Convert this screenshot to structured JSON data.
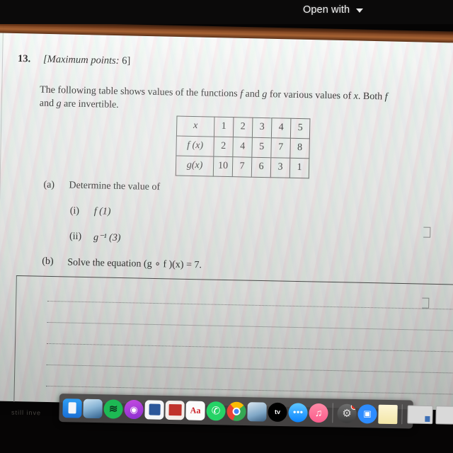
{
  "viewer": {
    "open_with_label": "Open with",
    "caret_icon": "chevron-down-icon"
  },
  "document": {
    "question_number": "13.",
    "marks_open": "[Maximum points:",
    "marks_value": " 6]",
    "stem_line1": "The following table shows values of the functions ",
    "stem_f1": "f",
    "stem_mid1": " and ",
    "stem_g1": "g",
    "stem_mid2": " for various values of ",
    "stem_x": "x",
    "stem_mid3": ". Both ",
    "stem_f2": "f",
    "stem_mid4": " and ",
    "stem_g2": "g",
    "stem_end": " are invertible.",
    "table": {
      "rows": [
        {
          "label": "x",
          "label_style": "italic",
          "values": [
            "1",
            "2",
            "3",
            "4",
            "5"
          ]
        },
        {
          "label": "f (x)",
          "label_style": "italic",
          "values": [
            "2",
            "4",
            "5",
            "7",
            "8"
          ]
        },
        {
          "label": "g(x)",
          "label_style": "italic",
          "values": [
            "10",
            "7",
            "6",
            "3",
            "1"
          ]
        }
      ]
    },
    "parts": [
      {
        "tag": "(a)",
        "text": "Determine the value of"
      },
      {
        "tag": "(i)",
        "text": "f (1)"
      },
      {
        "tag": "(ii)",
        "text": "g⁻¹ (3)"
      },
      {
        "tag": "(b)",
        "text": "Solve the equation (g ∘ f )(x) = 7."
      }
    ],
    "answer_lines": 5,
    "faint_bottom_text": "still inve"
  },
  "dock": {
    "items": [
      {
        "name": "finder",
        "running": true
      },
      {
        "name": "photos",
        "running": false
      },
      {
        "name": "spotify",
        "running": true,
        "glyph": "≋"
      },
      {
        "name": "podcasts",
        "running": false,
        "glyph": "◉"
      },
      {
        "name": "microsoft-office",
        "running": false
      },
      {
        "name": "red-app",
        "running": true
      },
      {
        "name": "adobe",
        "running": false,
        "glyph": "Aa"
      },
      {
        "name": "whatsapp",
        "running": false,
        "glyph": "✆"
      },
      {
        "name": "google-chrome",
        "running": true
      },
      {
        "name": "preview",
        "running": false
      },
      {
        "name": "apple-tv",
        "running": false,
        "glyph": "tv"
      },
      {
        "name": "messages",
        "running": true,
        "glyph": "●●●"
      },
      {
        "name": "music",
        "running": true,
        "glyph": "♫"
      },
      {
        "name": "system-preferences",
        "running": false,
        "glyph": "⚙",
        "badge": true
      },
      {
        "name": "zoom",
        "running": false,
        "glyph": "▣"
      },
      {
        "name": "stickies",
        "running": true
      }
    ],
    "minimized_windows": 2,
    "trash": "trash-icon"
  },
  "colors": {
    "dock_background": "#484646",
    "page_background": "#e3e3e1",
    "accent_red_badge": "#e6301e",
    "text": "#2c2b2a"
  }
}
